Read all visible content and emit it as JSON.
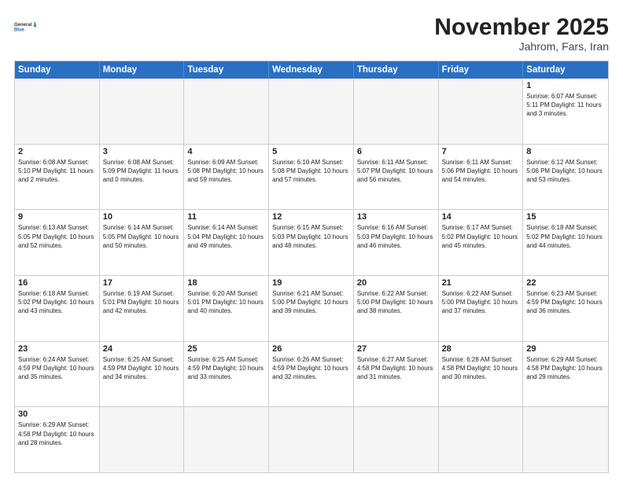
{
  "header": {
    "logo_general": "General",
    "logo_blue": "Blue",
    "month_title": "November 2025",
    "location": "Jahrom, Fars, Iran"
  },
  "days_of_week": [
    "Sunday",
    "Monday",
    "Tuesday",
    "Wednesday",
    "Thursday",
    "Friday",
    "Saturday"
  ],
  "weeks": [
    [
      {
        "day": "",
        "info": ""
      },
      {
        "day": "",
        "info": ""
      },
      {
        "day": "",
        "info": ""
      },
      {
        "day": "",
        "info": ""
      },
      {
        "day": "",
        "info": ""
      },
      {
        "day": "",
        "info": ""
      },
      {
        "day": "1",
        "info": "Sunrise: 6:07 AM\nSunset: 5:11 PM\nDaylight: 11 hours and 3 minutes."
      }
    ],
    [
      {
        "day": "2",
        "info": "Sunrise: 6:08 AM\nSunset: 5:10 PM\nDaylight: 11 hours and 2 minutes."
      },
      {
        "day": "3",
        "info": "Sunrise: 6:08 AM\nSunset: 5:09 PM\nDaylight: 11 hours and 0 minutes."
      },
      {
        "day": "4",
        "info": "Sunrise: 6:09 AM\nSunset: 5:08 PM\nDaylight: 10 hours and 59 minutes."
      },
      {
        "day": "5",
        "info": "Sunrise: 6:10 AM\nSunset: 5:08 PM\nDaylight: 10 hours and 57 minutes."
      },
      {
        "day": "6",
        "info": "Sunrise: 6:11 AM\nSunset: 5:07 PM\nDaylight: 10 hours and 56 minutes."
      },
      {
        "day": "7",
        "info": "Sunrise: 6:11 AM\nSunset: 5:06 PM\nDaylight: 10 hours and 54 minutes."
      },
      {
        "day": "8",
        "info": "Sunrise: 6:12 AM\nSunset: 5:06 PM\nDaylight: 10 hours and 53 minutes."
      }
    ],
    [
      {
        "day": "9",
        "info": "Sunrise: 6:13 AM\nSunset: 5:05 PM\nDaylight: 10 hours and 52 minutes."
      },
      {
        "day": "10",
        "info": "Sunrise: 6:14 AM\nSunset: 5:05 PM\nDaylight: 10 hours and 50 minutes."
      },
      {
        "day": "11",
        "info": "Sunrise: 6:14 AM\nSunset: 5:04 PM\nDaylight: 10 hours and 49 minutes."
      },
      {
        "day": "12",
        "info": "Sunrise: 6:15 AM\nSunset: 5:03 PM\nDaylight: 10 hours and 48 minutes."
      },
      {
        "day": "13",
        "info": "Sunrise: 6:16 AM\nSunset: 5:03 PM\nDaylight: 10 hours and 46 minutes."
      },
      {
        "day": "14",
        "info": "Sunrise: 6:17 AM\nSunset: 5:02 PM\nDaylight: 10 hours and 45 minutes."
      },
      {
        "day": "15",
        "info": "Sunrise: 6:18 AM\nSunset: 5:02 PM\nDaylight: 10 hours and 44 minutes."
      }
    ],
    [
      {
        "day": "16",
        "info": "Sunrise: 6:18 AM\nSunset: 5:02 PM\nDaylight: 10 hours and 43 minutes."
      },
      {
        "day": "17",
        "info": "Sunrise: 6:19 AM\nSunset: 5:01 PM\nDaylight: 10 hours and 42 minutes."
      },
      {
        "day": "18",
        "info": "Sunrise: 6:20 AM\nSunset: 5:01 PM\nDaylight: 10 hours and 40 minutes."
      },
      {
        "day": "19",
        "info": "Sunrise: 6:21 AM\nSunset: 5:00 PM\nDaylight: 10 hours and 39 minutes."
      },
      {
        "day": "20",
        "info": "Sunrise: 6:22 AM\nSunset: 5:00 PM\nDaylight: 10 hours and 38 minutes."
      },
      {
        "day": "21",
        "info": "Sunrise: 6:22 AM\nSunset: 5:00 PM\nDaylight: 10 hours and 37 minutes."
      },
      {
        "day": "22",
        "info": "Sunrise: 6:23 AM\nSunset: 4:59 PM\nDaylight: 10 hours and 36 minutes."
      }
    ],
    [
      {
        "day": "23",
        "info": "Sunrise: 6:24 AM\nSunset: 4:59 PM\nDaylight: 10 hours and 35 minutes."
      },
      {
        "day": "24",
        "info": "Sunrise: 6:25 AM\nSunset: 4:59 PM\nDaylight: 10 hours and 34 minutes."
      },
      {
        "day": "25",
        "info": "Sunrise: 6:25 AM\nSunset: 4:59 PM\nDaylight: 10 hours and 33 minutes."
      },
      {
        "day": "26",
        "info": "Sunrise: 6:26 AM\nSunset: 4:59 PM\nDaylight: 10 hours and 32 minutes."
      },
      {
        "day": "27",
        "info": "Sunrise: 6:27 AM\nSunset: 4:58 PM\nDaylight: 10 hours and 31 minutes."
      },
      {
        "day": "28",
        "info": "Sunrise: 6:28 AM\nSunset: 4:58 PM\nDaylight: 10 hours and 30 minutes."
      },
      {
        "day": "29",
        "info": "Sunrise: 6:29 AM\nSunset: 4:58 PM\nDaylight: 10 hours and 29 minutes."
      }
    ],
    [
      {
        "day": "30",
        "info": "Sunrise: 6:29 AM\nSunset: 4:58 PM\nDaylight: 10 hours and 28 minutes."
      },
      {
        "day": "",
        "info": ""
      },
      {
        "day": "",
        "info": ""
      },
      {
        "day": "",
        "info": ""
      },
      {
        "day": "",
        "info": ""
      },
      {
        "day": "",
        "info": ""
      },
      {
        "day": "",
        "info": ""
      }
    ]
  ]
}
